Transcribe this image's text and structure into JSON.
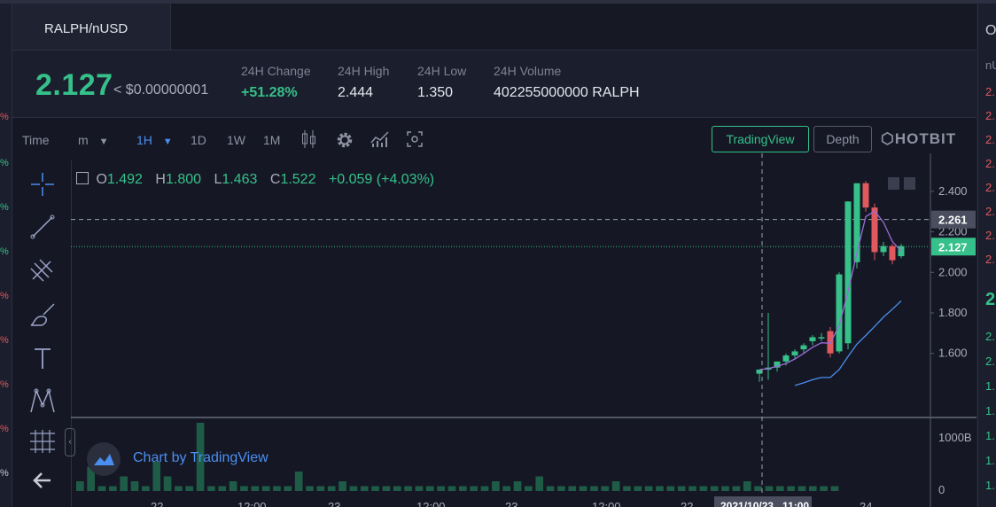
{
  "pair": "RALPH/nUSD",
  "ticker": {
    "price": "2.127",
    "usd_value": "< $0.00000001",
    "change_label": "24H Change",
    "change_value": "+51.28%",
    "high_label": "24H High",
    "high_value": "2.444",
    "low_label": "24H Low",
    "low_value": "1.350",
    "volume_label": "24H Volume",
    "volume_value": "402255000000 RALPH"
  },
  "toolbar": {
    "time_label": "Time",
    "minutes_label": "m",
    "interval_1h": "1H",
    "interval_1d": "1D",
    "interval_1w": "1W",
    "interval_1m": "1M",
    "tradingview_label": "TradingView",
    "depth_label": "Depth",
    "brand": "HOTBIT"
  },
  "ohlc": {
    "o_key": "O",
    "o_val": "1.492",
    "h_key": "H",
    "h_val": "1.800",
    "l_key": "L",
    "l_val": "1.463",
    "c_key": "C",
    "c_val": "1.522",
    "change": "+0.059 (+4.03%)"
  },
  "watermark": "Chart by TradingView",
  "price_axis": {
    "ticks": [
      "2.400",
      "2.200",
      "2.000",
      "1.800",
      "1.600"
    ],
    "tick_values": [
      2.4,
      2.2,
      2.0,
      1.8,
      1.6
    ],
    "crosshair_label": "2.261",
    "crosshair_value": 2.261,
    "last_label": "2.127",
    "last_value": 2.127
  },
  "volume_axis": {
    "ticks": [
      "1000B",
      "0"
    ]
  },
  "time_axis": {
    "crosshair_label": "2021/10/23 . 11:00",
    "partial_ticks": [
      "22",
      "12:00",
      "23",
      "12:00",
      "23",
      "12:00",
      "22",
      "24"
    ]
  },
  "colors": {
    "up": "#36c08a",
    "down": "#e0595f",
    "accent": "#4a8ef0"
  },
  "chart_data": {
    "type": "candlestick",
    "title": "",
    "ylim": [
      1.45,
      2.5
    ],
    "candles": [
      {
        "o": 1.5,
        "h": 1.52,
        "l": 1.46,
        "c": 1.52
      },
      {
        "o": 1.52,
        "h": 1.8,
        "l": 1.47,
        "c": 1.53
      },
      {
        "o": 1.53,
        "h": 1.56,
        "l": 1.51,
        "c": 1.56
      },
      {
        "o": 1.56,
        "h": 1.6,
        "l": 1.54,
        "c": 1.59
      },
      {
        "o": 1.59,
        "h": 1.62,
        "l": 1.57,
        "c": 1.61
      },
      {
        "o": 1.62,
        "h": 1.65,
        "l": 1.6,
        "c": 1.64
      },
      {
        "o": 1.66,
        "h": 1.69,
        "l": 1.64,
        "c": 1.68
      },
      {
        "o": 1.68,
        "h": 1.7,
        "l": 1.66,
        "c": 1.68
      },
      {
        "o": 1.71,
        "h": 1.73,
        "l": 1.58,
        "c": 1.6
      },
      {
        "o": 1.61,
        "h": 2.0,
        "l": 1.6,
        "c": 1.99
      },
      {
        "o": 1.65,
        "h": 2.35,
        "l": 1.62,
        "c": 2.35
      },
      {
        "o": 2.05,
        "h": 2.42,
        "l": 2.02,
        "c": 2.44
      },
      {
        "o": 2.44,
        "h": 2.45,
        "l": 2.3,
        "c": 2.32
      },
      {
        "o": 2.32,
        "h": 2.34,
        "l": 2.06,
        "c": 2.1
      },
      {
        "o": 2.1,
        "h": 2.15,
        "l": 2.08,
        "c": 2.13
      },
      {
        "o": 2.13,
        "h": 2.14,
        "l": 2.04,
        "c": 2.06
      },
      {
        "o": 2.08,
        "h": 2.14,
        "l": 2.07,
        "c": 2.13
      }
    ],
    "volume_ticks": [
      "1000B",
      "0"
    ],
    "volume": [
      2,
      5,
      1,
      1,
      3,
      2,
      1,
      6,
      3,
      1,
      1,
      14,
      1,
      1,
      2,
      1,
      1,
      1,
      1,
      1,
      4,
      1,
      1,
      1,
      2,
      1,
      1,
      1,
      1,
      1,
      1,
      1,
      1,
      1,
      1,
      1,
      1,
      1,
      2,
      1,
      2,
      1,
      3,
      1,
      1,
      1,
      1,
      1,
      1,
      2,
      1,
      1,
      1,
      1,
      1,
      1,
      1,
      1,
      1,
      1,
      1,
      2,
      1,
      1,
      1,
      1,
      1,
      1,
      1,
      1
    ]
  }
}
